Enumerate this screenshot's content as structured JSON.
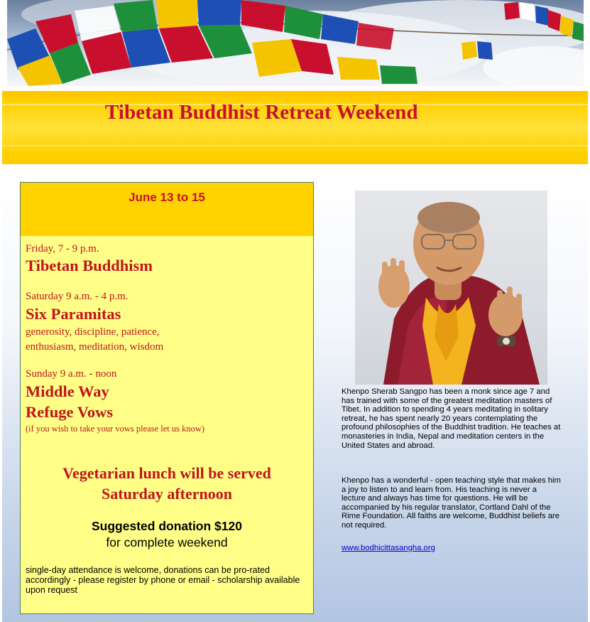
{
  "header": {
    "title": "Tibetan Buddhist Retreat Weekend",
    "banner_icon": "prayer-flags-image",
    "flag_colors": [
      "#1d4fb5",
      "#ffffff",
      "#c8102e",
      "#1e8f3a",
      "#f5c400"
    ]
  },
  "schedule": {
    "date_range": "June 13 to 15",
    "sessions": [
      {
        "time": "Friday, 7 - 9 p.m.",
        "titles": [
          "Tibetan Buddhism"
        ]
      },
      {
        "time": "Saturday 9 a.m. - 4 p.m.",
        "titles": [
          "Six Paramitas"
        ],
        "description": [
          "generosity, discipline, patience,",
          "enthusiasm, meditation, wisdom"
        ]
      },
      {
        "time": "Sunday 9 a.m. - noon",
        "titles": [
          "Middle Way",
          "Refuge Vows"
        ],
        "note": "(if you wish to take your vows please let us know)"
      }
    ],
    "lunch": {
      "line1": "Vegetarian lunch will be served",
      "line2": "Saturday afternoon"
    },
    "donation": {
      "amount_line": "Suggested donation $120",
      "sub_line": "for complete weekend"
    },
    "attendance_note": "single-day attendance is welcome, donations can be pro-rated accordingly - please register by phone or email - scholarship available upon request"
  },
  "teacher": {
    "photo_icon": "monk-portrait-image",
    "bio_paragraph_1": "Khenpo Sherab Sangpo has been a monk since age 7 and has trained with some of the greatest meditation masters of Tibet. In addition to spending 4 years meditating in solitary retreat, he has spent nearly 20 years contemplating the profound philosophies of the Buddhist tradition. He teaches at monasteries in India, Nepal and meditation centers in the United States and abroad.",
    "bio_paragraph_2": "Khenpo has a wonderful - open teaching style that makes him a joy to listen to and learn from. His teaching is never a lecture and always has time for questions. He will be accompanied by his regular translator, Cortland Dahl of the Rime Foundation. All faiths are welcome, Buddhist beliefs are not required.",
    "website": "www.bodhicittasangha.org"
  },
  "colors": {
    "title_red": "#c8102e",
    "band_yellow": "#ffd200",
    "card_yellow": "#ffff88",
    "link_blue": "#0000cc"
  }
}
